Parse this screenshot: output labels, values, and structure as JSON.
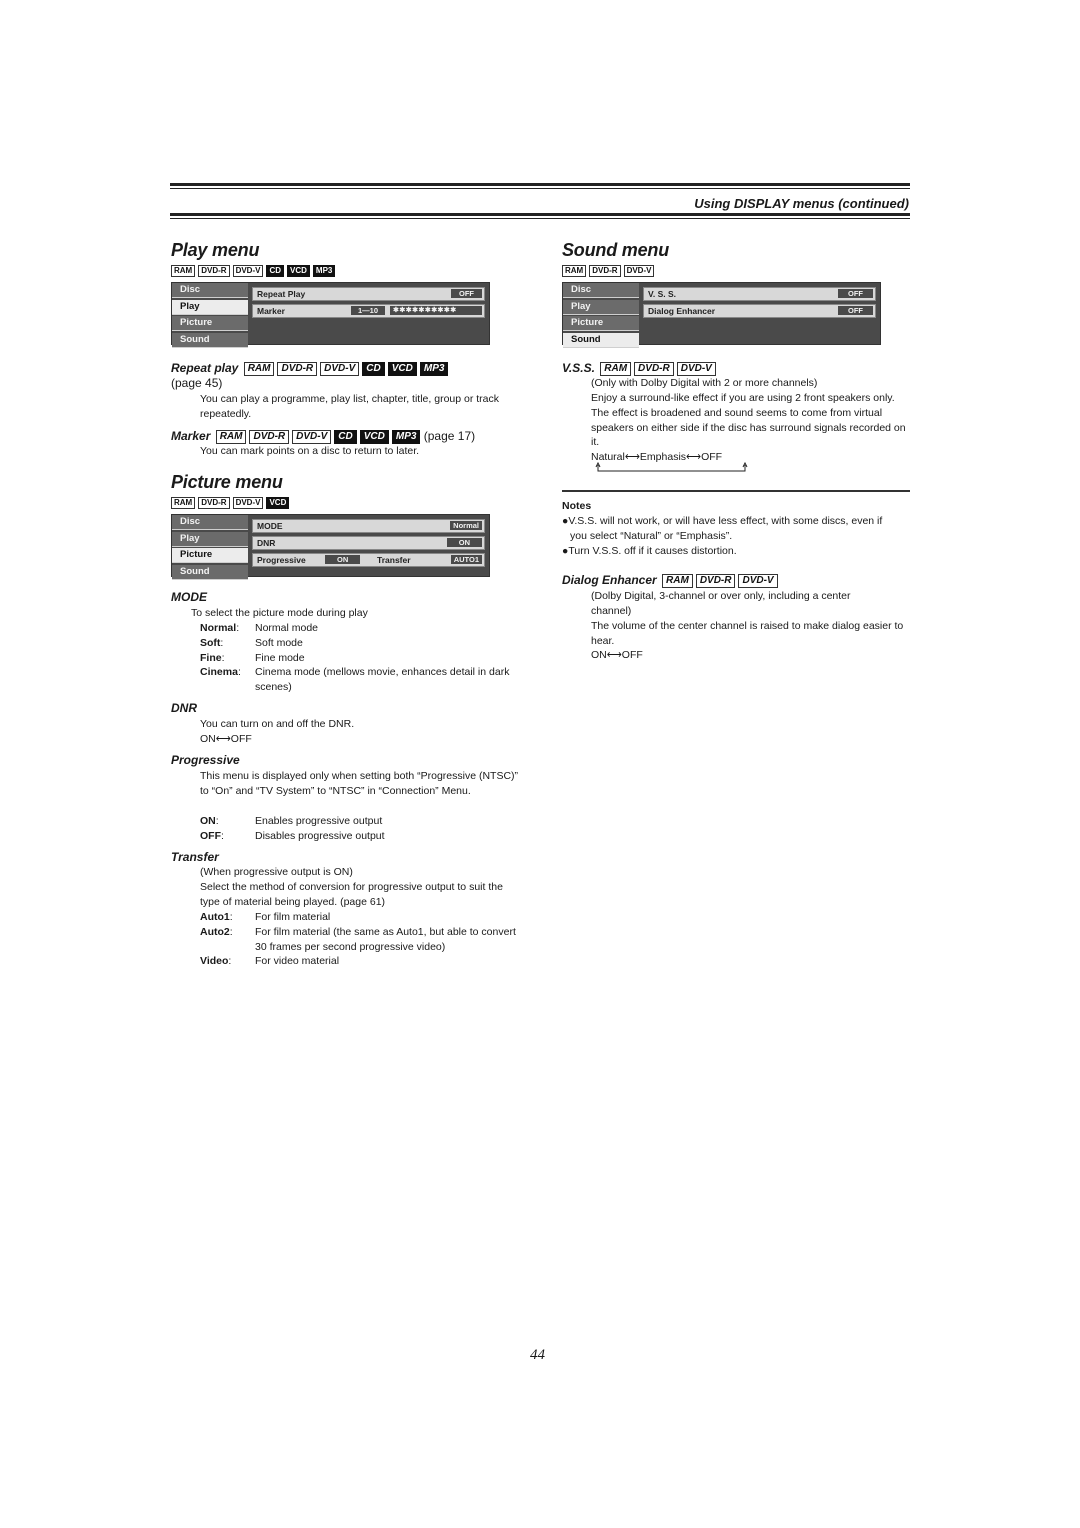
{
  "header": {
    "title": "Using DISPLAY menus (continued)"
  },
  "play_menu": {
    "title": "Play menu",
    "badges": [
      {
        "label": "RAM",
        "inverted": false
      },
      {
        "label": "DVD-R",
        "inverted": false
      },
      {
        "label": "DVD-V",
        "inverted": false
      },
      {
        "label": "CD",
        "inverted": true
      },
      {
        "label": "VCD",
        "inverted": true
      },
      {
        "label": "MP3",
        "inverted": true
      }
    ],
    "osd": {
      "tabs": [
        "Disc",
        "Play",
        "Picture",
        "Sound"
      ],
      "active_tab": "Play",
      "rows": [
        {
          "label": "Repeat Play",
          "value": "OFF"
        },
        {
          "label": "Marker",
          "range": "1—10",
          "value": "✱✱✱✱✱✱✱✱✱✱"
        }
      ]
    },
    "repeat_play": {
      "heading": "Repeat play",
      "page_ref": "(page 45)",
      "text": "You can play a programme, play list, chapter, title, group or track repeatedly."
    },
    "marker": {
      "heading": "Marker",
      "page_ref": "(page 17)",
      "text": "You can mark points on a disc to return to later."
    }
  },
  "picture_menu": {
    "title": "Picture menu",
    "badges": [
      {
        "label": "RAM",
        "inverted": false
      },
      {
        "label": "DVD-R",
        "inverted": false
      },
      {
        "label": "DVD-V",
        "inverted": false
      },
      {
        "label": "VCD",
        "inverted": true
      }
    ],
    "osd": {
      "tabs": [
        "Disc",
        "Play",
        "Picture",
        "Sound"
      ],
      "active_tab": "Picture",
      "rows": [
        {
          "label": "MODE",
          "value": "Normal"
        },
        {
          "label": "DNR",
          "value": "ON"
        },
        {
          "label": "Progressive",
          "value": "ON",
          "label2": "Transfer",
          "value2": "AUTO1"
        }
      ]
    },
    "mode": {
      "heading": "MODE",
      "intro": "To select the picture mode during play",
      "options": [
        {
          "term": "Normal",
          "desc": "Normal mode"
        },
        {
          "term": "Soft",
          "desc": "Soft mode"
        },
        {
          "term": "Fine",
          "desc": "Fine mode"
        },
        {
          "term": "Cinema",
          "desc": "Cinema mode (mellows movie, enhances detail in dark scenes)"
        }
      ]
    },
    "dnr": {
      "heading": "DNR",
      "text": "You can turn on and off the DNR.",
      "cycle": "ON⟷OFF"
    },
    "progressive": {
      "heading": "Progressive",
      "text": "This menu is displayed only when setting both “Progressive (NTSC)” to “On” and “TV System” to “NTSC” in “Connection” Menu.",
      "options": [
        {
          "term": "ON",
          "desc": "Enables progressive output"
        },
        {
          "term": "OFF",
          "desc": "Disables progressive output"
        }
      ]
    },
    "transfer": {
      "heading": "Transfer",
      "note": "(When progressive output is ON)",
      "text": "Select the method of conversion for progressive output to suit the type of material being played. (page 61)",
      "options": [
        {
          "term": "Auto1",
          "desc": "For film material"
        },
        {
          "term": "Auto2",
          "desc": "For film material (the same as Auto1, but able to convert 30 frames per second progressive video)"
        },
        {
          "term": "Video",
          "desc": "For video material"
        }
      ]
    }
  },
  "sound_menu": {
    "title": "Sound menu",
    "badges": [
      {
        "label": "RAM",
        "inverted": false
      },
      {
        "label": "DVD-R",
        "inverted": false
      },
      {
        "label": "DVD-V",
        "inverted": false
      }
    ],
    "osd": {
      "tabs": [
        "Disc",
        "Play",
        "Picture",
        "Sound"
      ],
      "active_tab": "Sound",
      "rows": [
        {
          "label": "V. S. S.",
          "value": "OFF"
        },
        {
          "label": "Dialog Enhancer",
          "value": "OFF"
        }
      ]
    },
    "vss": {
      "heading": "V.S.S.",
      "note": "(Only with Dolby Digital with 2 or more channels)",
      "text": "Enjoy a surround-like effect if you are using 2 front speakers only. The effect is broadened and sound seems to come from virtual speakers on either side if the disc has surround signals recorded on it.",
      "cycle": [
        "Natural",
        "Emphasis",
        "OFF"
      ]
    },
    "notes": {
      "heading": "Notes",
      "items": [
        "V.S.S. will not work, or will have less effect, with some discs, even if you select “Natural” or “Emphasis”.",
        "Turn V.S.S. off if it causes distortion."
      ]
    },
    "dialog_enhancer": {
      "heading": "Dialog Enhancer",
      "note": "(Dolby Digital, 3-channel or over only, including a center channel)",
      "text": "The volume of the center channel is raised to make dialog easier to hear.",
      "cycle": "ON⟷OFF"
    }
  },
  "footer": {
    "page_number": "44"
  }
}
